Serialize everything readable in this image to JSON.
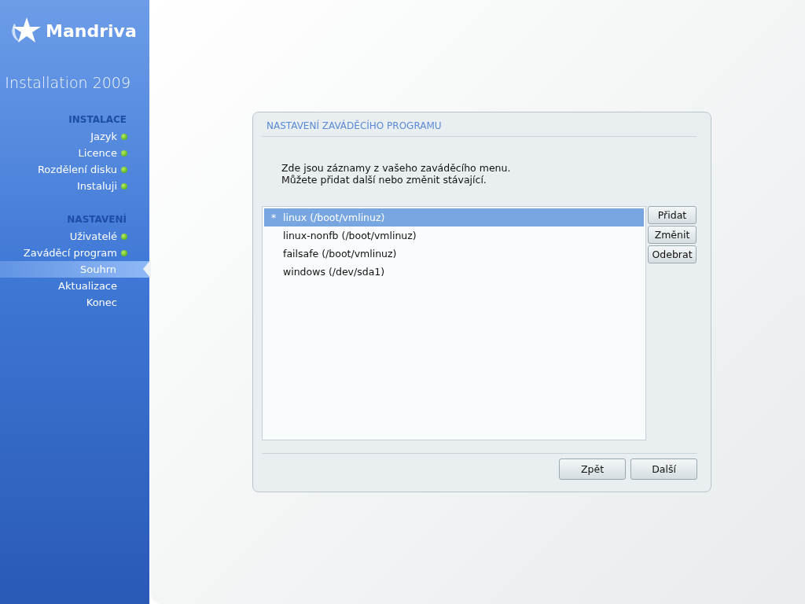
{
  "sidebar": {
    "logo": "Mandriva",
    "subtitle": "Installation 2009",
    "sections": [
      {
        "title": "INSTALACE",
        "items": [
          {
            "label": "Jazyk",
            "done": true,
            "selected": false
          },
          {
            "label": "Licence",
            "done": true,
            "selected": false
          },
          {
            "label": "Rozdělení disku",
            "done": true,
            "selected": false
          },
          {
            "label": "Instaluji",
            "done": true,
            "selected": false
          }
        ]
      },
      {
        "title": "NASTAVENÍ",
        "items": [
          {
            "label": "Uživatelé",
            "done": true,
            "selected": false
          },
          {
            "label": "Zaváděcí program",
            "done": true,
            "selected": false
          },
          {
            "label": "Souhrn",
            "done": false,
            "selected": true
          },
          {
            "label": "Aktualizace",
            "done": false,
            "selected": false
          },
          {
            "label": "Konec",
            "done": false,
            "selected": false
          }
        ]
      }
    ]
  },
  "dialog": {
    "title": "NASTAVENÍ ZAVÁDĚCÍHO PROGRAMU",
    "intro": [
      "Zde jsou záznamy z vašeho zaváděcího menu.",
      "Můžete přidat další nebo změnit stávající."
    ],
    "entries": [
      {
        "marker": "*",
        "label": "linux (/boot/vmlinuz)",
        "selected": true
      },
      {
        "label": "linux-nonfb (/boot/vmlinuz)",
        "selected": false
      },
      {
        "label": "failsafe (/boot/vmlinuz)",
        "selected": false
      },
      {
        "label": "windows (/dev/sda1)",
        "selected": false
      }
    ],
    "side_buttons": [
      "Přidat",
      "Změnit",
      "Odebrat"
    ],
    "buttons": [
      "Zpět",
      "Další"
    ]
  }
}
